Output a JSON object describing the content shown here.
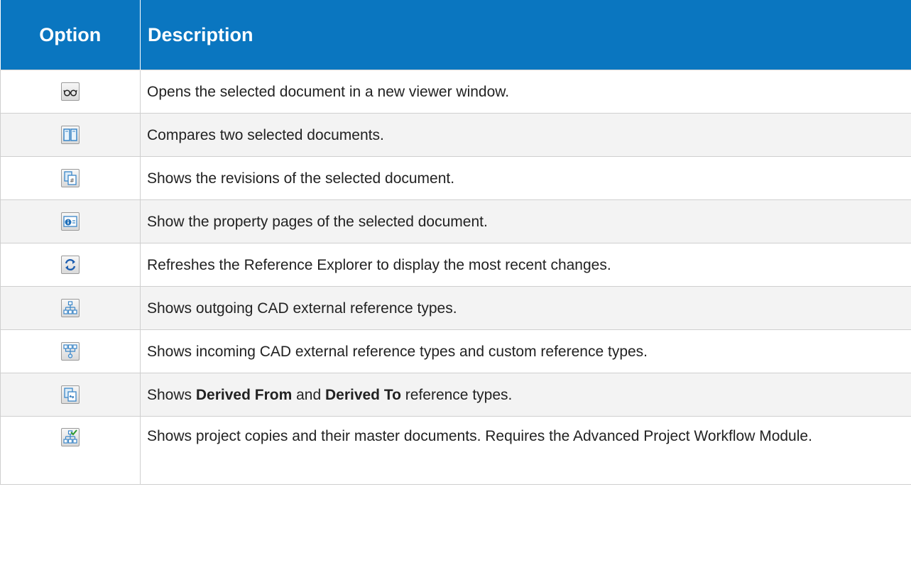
{
  "header": {
    "option": "Option",
    "description": "Description"
  },
  "rows": [
    {
      "icon": "glasses-icon",
      "description": "Opens the selected document in a new viewer window."
    },
    {
      "icon": "compare-documents-icon",
      "description": "Compares two selected documents."
    },
    {
      "icon": "revisions-icon",
      "description": "Shows the revisions of the selected document."
    },
    {
      "icon": "properties-icon",
      "description": "Show the property pages of the selected document."
    },
    {
      "icon": "refresh-icon",
      "description": "Refreshes the Reference Explorer to display the most recent changes."
    },
    {
      "icon": "outgoing-references-icon",
      "description": "Shows outgoing CAD external reference types."
    },
    {
      "icon": "incoming-references-icon",
      "description": "Shows incoming CAD external reference types and custom reference types."
    },
    {
      "icon": "derived-references-icon",
      "description_parts": [
        "Shows ",
        "Derived From",
        " and ",
        "Derived To",
        " reference types."
      ]
    },
    {
      "icon": "project-copies-icon",
      "description": "Shows project copies and their master documents. Requires the Advanced Project Workflow Module."
    }
  ]
}
